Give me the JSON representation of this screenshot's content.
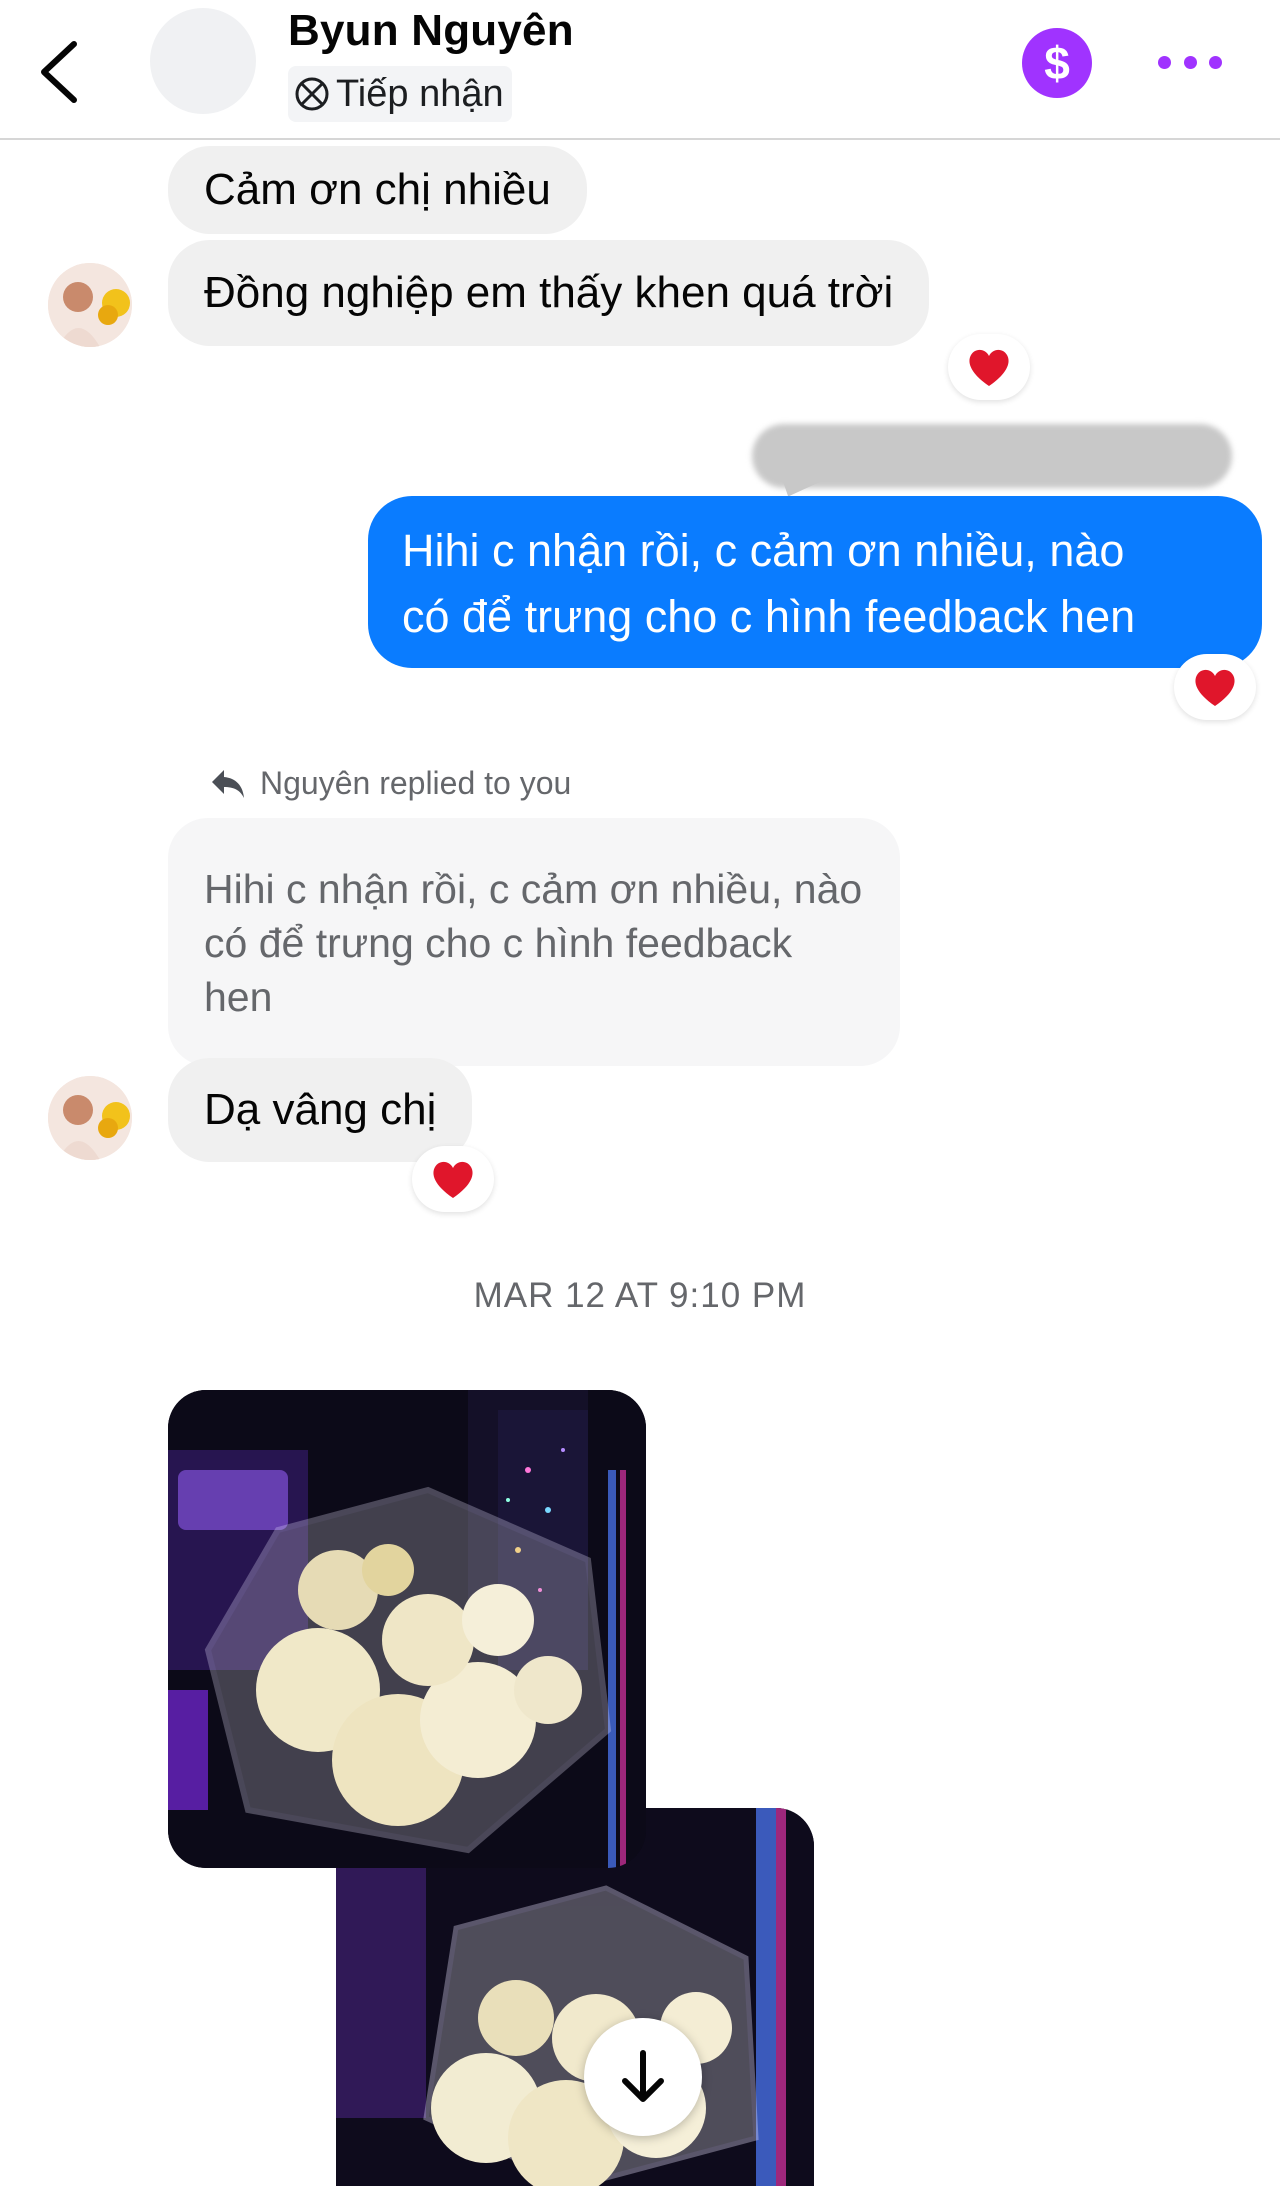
{
  "header": {
    "contact_name": "Byun Nguyên",
    "status": "Tiếp nhận",
    "back_icon": "chevron-left-icon",
    "pay_icon": "dollar-icon",
    "more_icon": "more-dots-icon",
    "accent_color": "#a033ff"
  },
  "messages": {
    "incoming_1": "Cảm ơn chị nhiều",
    "incoming_2": "Đồng nghiệp em thấy khen quá trời",
    "outgoing_1": {
      "line_1": "Hihi c nhận rồi, c cảm ơn nhiều, nào",
      "line_2": "có để trưng cho c hình feedback hen"
    },
    "reply_label": "Nguyên replied to you",
    "quoted_text": "Hihi c nhận rồi, c cảm ơn nhiều, nào có để trưng cho c hình feedback hen",
    "incoming_3": "Dạ vâng chị",
    "timestamp": "MAR 12 AT 9:10 PM"
  },
  "reaction_icon": "heart-icon",
  "colors": {
    "outgoing_bubble": "#0a7cff",
    "incoming_bubble": "#f0f0f0",
    "heart": "#e0162b"
  },
  "scroll_icon": "arrow-down-icon"
}
